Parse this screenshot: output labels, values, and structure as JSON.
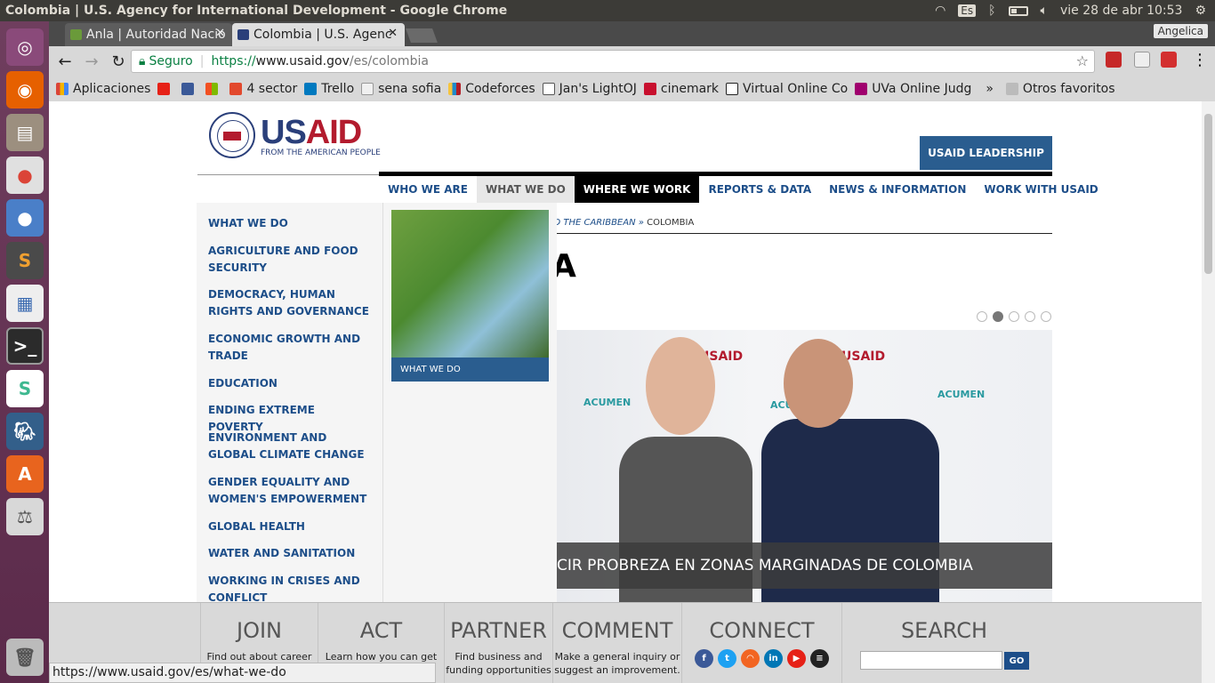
{
  "os": {
    "window_title": "Colombia | U.S. Agency for International Development - Google Chrome",
    "keyboard": "Es",
    "clock": "vie 28 de abr 10:53"
  },
  "browser": {
    "tabs": [
      {
        "label": "Anla | Autoridad Nacio"
      },
      {
        "label": "Colombia | U.S. Agenc"
      }
    ],
    "user": "Angelica",
    "omnibox": {
      "secure_label": "Seguro",
      "scheme": "https://",
      "domain": "www.usaid.gov",
      "path": "/es/colombia"
    },
    "bookmarks": [
      "Aplicaciones",
      "4 sector",
      "Trello",
      "sena sofia",
      "Codeforces",
      "Jan's LightOJ",
      "cinemark",
      "Virtual Online Co",
      "UVa Online Judg",
      "»",
      "Otros favoritos"
    ],
    "status_url": "https://www.usaid.gov/es/what-we-do"
  },
  "site": {
    "logo_text_us": "US",
    "logo_text_aid": "AID",
    "logo_tagline": "FROM THE AMERICAN PEOPLE",
    "leadership_btn": "USAID LEADERSHIP",
    "nav": [
      "WHO WE ARE",
      "WHAT WE DO",
      "WHERE WE WORK",
      "REPORTS & DATA",
      "NEWS & INFORMATION",
      "WORK WITH USAID"
    ],
    "breadcrumb_part": "ND THE CARIBBEAN",
    "breadcrumb_sep": " » ",
    "breadcrumb_current": "COLOMBIA",
    "heading_fragment": "A",
    "hero_caption": "CIR PROBREZA EN ZONAS MARGINADAS DE COLOMBIA",
    "hero_wall_brand": "USAID",
    "hero_wall_acumen": "ACUMEN",
    "dropdown": {
      "items": [
        "WHAT WE DO",
        "AGRICULTURE AND FOOD SECURITY",
        "DEMOCRACY, HUMAN RIGHTS AND GOVERNANCE",
        "ECONOMIC GROWTH AND TRADE",
        "EDUCATION",
        "ENDING EXTREME POVERTY",
        "ENVIRONMENT AND GLOBAL CLIMATE CHANGE",
        "GENDER EQUALITY AND WOMEN'S EMPOWERMENT",
        "GLOBAL HEALTH",
        "WATER AND SANITATION",
        "WORKING IN CRISES AND CONFLICT"
      ],
      "card_caption": "WHAT WE DO"
    },
    "footer": {
      "join": {
        "title": "JOIN",
        "text": "Find out about career"
      },
      "act": {
        "title": "ACT",
        "text": "Learn how you can get"
      },
      "partner": {
        "title": "PARTNER",
        "text": "Find business and funding opportunities"
      },
      "comment": {
        "title": "COMMENT",
        "text": "Make a general inquiry or suggest an improvement."
      },
      "connect": {
        "title": "CONNECT"
      },
      "search": {
        "title": "SEARCH",
        "button": "GO"
      }
    }
  }
}
